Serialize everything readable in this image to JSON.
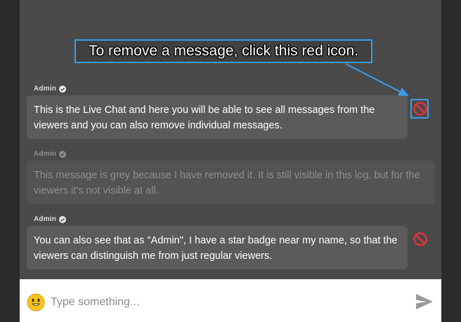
{
  "callout": {
    "text": "To remove a message, click this red icon."
  },
  "messages": [
    {
      "author": "Admin",
      "text": "This is the Live Chat and here you will be able to see all messages from the viewers and you can also remove individual messages.",
      "removed": false
    },
    {
      "author": "Admin",
      "text": "This message is grey because I have removed it. It is still visible in this log, but for the viewers it's not visible at all.",
      "removed": true
    },
    {
      "author": "Admin",
      "text": "You can also see that as \"Admin\", I have a star badge near my name, so that the viewers can distinguish me from just regular viewers.",
      "removed": false
    }
  ],
  "composer": {
    "placeholder": "Type something...",
    "value": ""
  },
  "icons": {
    "remove": "remove-message-icon",
    "badge": "verified-badge-icon",
    "emoji": "smiley-emoji-icon",
    "send": "send-arrow-icon"
  },
  "colors": {
    "panel": "#4a4a4a",
    "bubble": "#5b5b5b",
    "remove_red": "#e0323a",
    "callout_blue": "#3d9be9"
  }
}
